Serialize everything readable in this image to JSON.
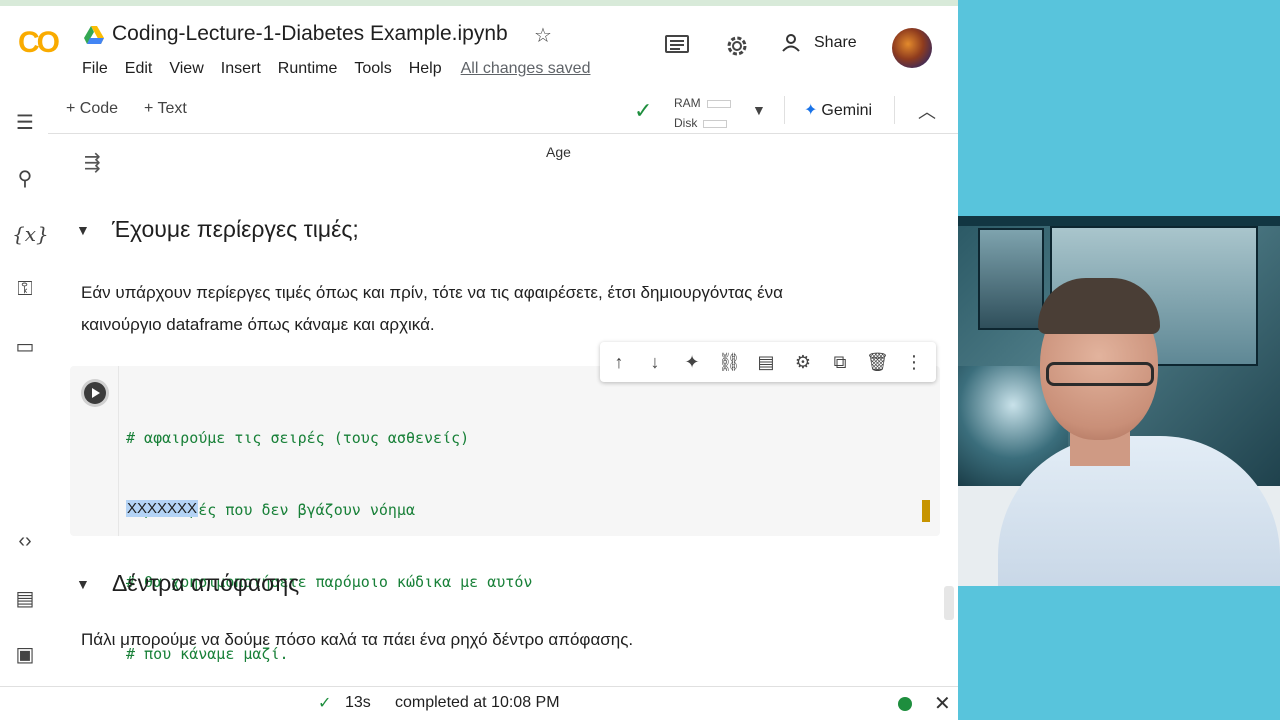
{
  "header": {
    "logo": "CO",
    "doc_title": "Coding-Lecture-1-Diabetes Example.ipynb",
    "menu": [
      "File",
      "Edit",
      "View",
      "Insert",
      "Runtime",
      "Tools",
      "Help"
    ],
    "save_status": "All changes saved",
    "share_label": "Share"
  },
  "toolbar": {
    "code_label": "Code",
    "text_label": "Text",
    "ram_label": "RAM",
    "disk_label": "Disk",
    "gemini_label": "Gemini"
  },
  "main": {
    "plot_axis_label": "Age",
    "section1_title": "Έχουμε περίεργες τιμές;",
    "section1_text_line1": "Εάν υπάρχουν περίεργες τιμές όπως και πρίν, τότε να τις αφαιρέσετε, έτσι δημιουργόντας ένα",
    "section1_text_line2": "καινούργιο dataframe όπως κάναμε και αρχικά.",
    "code_lines": [
      "# αφαιρούμε τις σειρές (τους ασθενείς)",
      "# με τιμές που δεν βγάζουν νόημα",
      "# θα χρησιμοποιήσετε παρόμοιο κώδικα με αυτόν",
      "# που κάναμε μαζί."
    ],
    "code_selected": "XXXXXXX",
    "section2_title": "Δέντρα απόφασης",
    "section2_text": "Πάλι μπορούμε να δούμε πόσο καλά τα πάει ένα ρηχό δέντρο απόφασης."
  },
  "status": {
    "elapsed": "13s",
    "completed": "completed at 10:08 PM"
  },
  "colors": {
    "accent_orange": "#f9ab00",
    "check_green": "#1e8e3e",
    "code_green": "#188038",
    "right_bg": "#58c4dc"
  }
}
